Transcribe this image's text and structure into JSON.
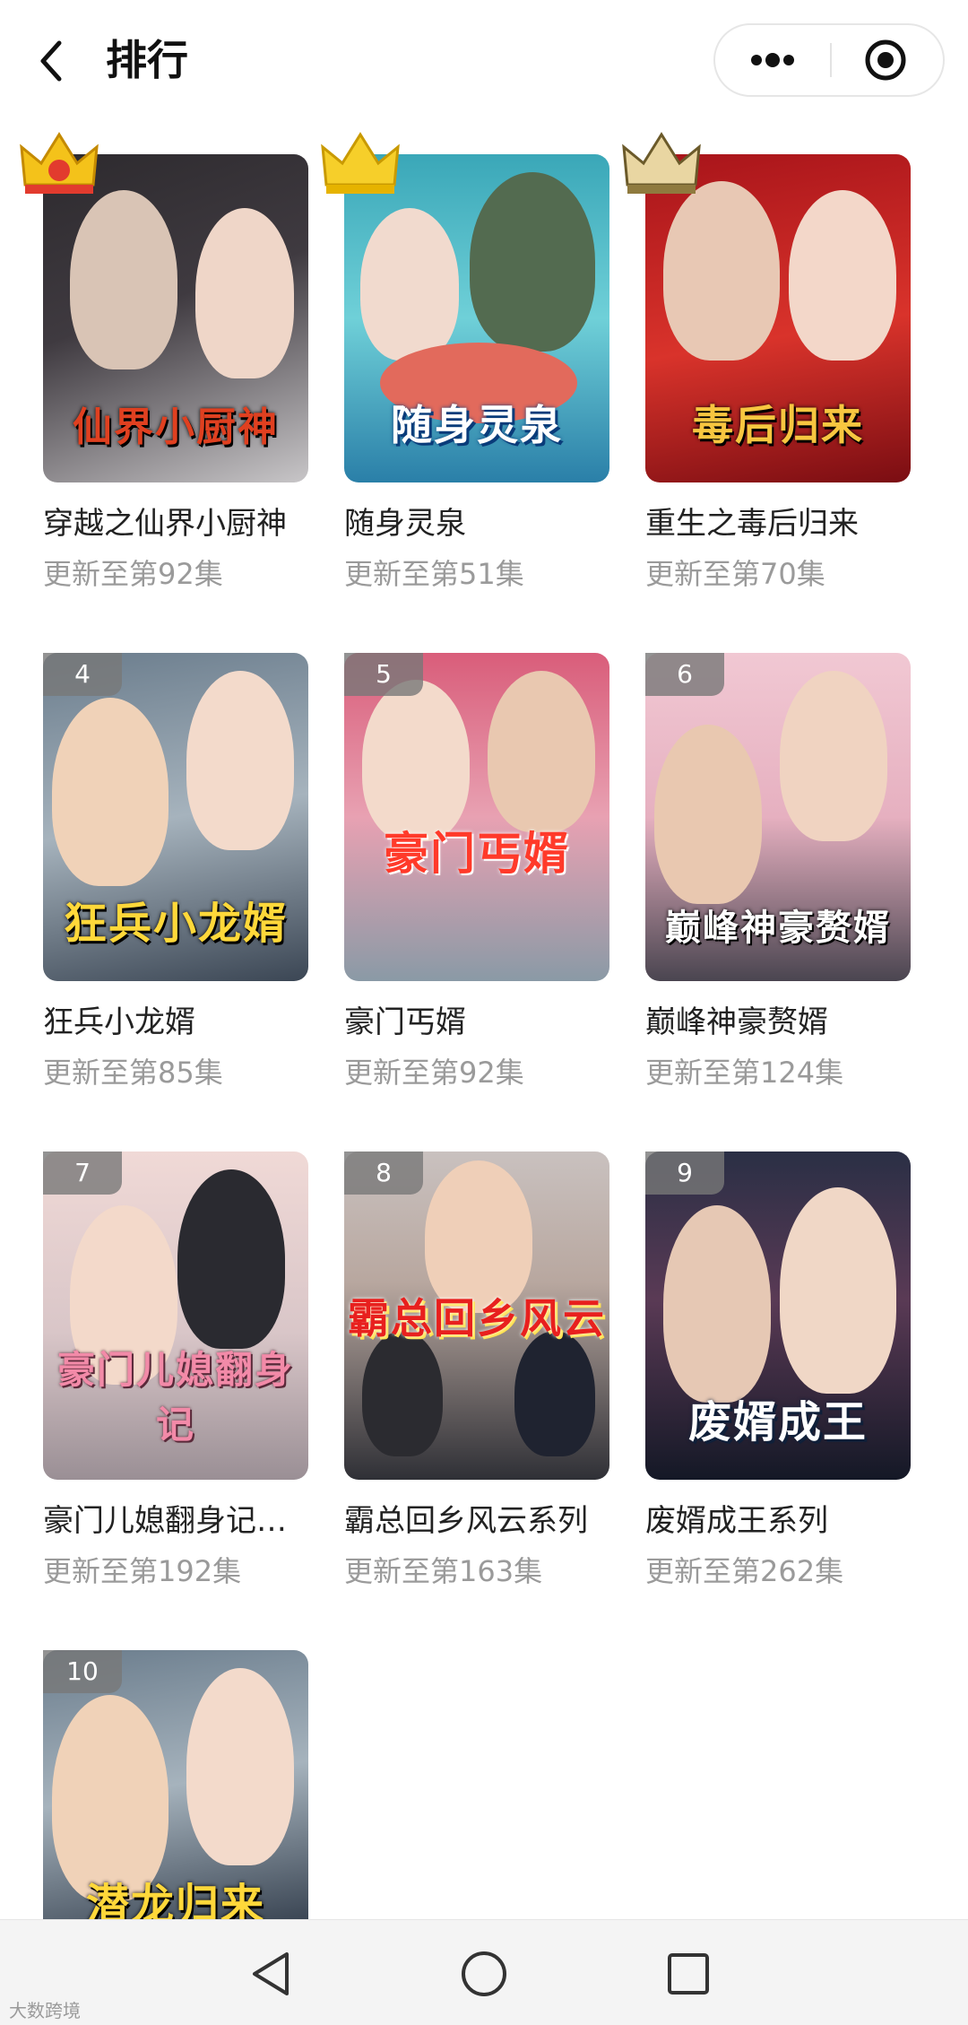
{
  "header": {
    "title": "排行"
  },
  "colors": {
    "rank_badge": "#787878",
    "episode_text": "#9a9a9a",
    "crown_gold": "#f4c21a",
    "crown_red": "#e23b2e"
  },
  "items": [
    {
      "rank": "1",
      "name": "穿越之仙界小厨神",
      "episodes": "更新至第92集",
      "poster_text": "仙界小厨神",
      "crown": "gold-red-crown-icon"
    },
    {
      "rank": "2",
      "name": "随身灵泉",
      "episodes": "更新至第51集",
      "poster_text": "随身灵泉",
      "crown": "gold-crown-icon"
    },
    {
      "rank": "3",
      "name": "重生之毒后归来",
      "episodes": "更新至第70集",
      "poster_text": "毒后归来",
      "crown": "bronze-crown-icon"
    },
    {
      "rank": "4",
      "name": "狂兵小龙婿",
      "episodes": "更新至第85集",
      "poster_text": "狂兵小龙婿"
    },
    {
      "rank": "5",
      "name": "豪门丐婿",
      "episodes": "更新至第92集",
      "poster_text": "豪门丐婿"
    },
    {
      "rank": "6",
      "name": "巅峰神豪赘婿",
      "episodes": "更新至第124集",
      "poster_text": "巅峰神豪赘婿"
    },
    {
      "rank": "7",
      "name": "豪门儿媳翻身记…",
      "episodes": "更新至第192集",
      "poster_text": "豪门儿媳翻身记"
    },
    {
      "rank": "8",
      "name": "霸总回乡风云系列",
      "episodes": "更新至第163集",
      "poster_text": "霸总回乡风云"
    },
    {
      "rank": "9",
      "name": "废婿成王系列",
      "episodes": "更新至第262集",
      "poster_text": "废婿成王"
    },
    {
      "rank": "10",
      "name": "",
      "episodes": "",
      "poster_text": "潜龙归来"
    }
  ],
  "watermark": "大数跨境"
}
